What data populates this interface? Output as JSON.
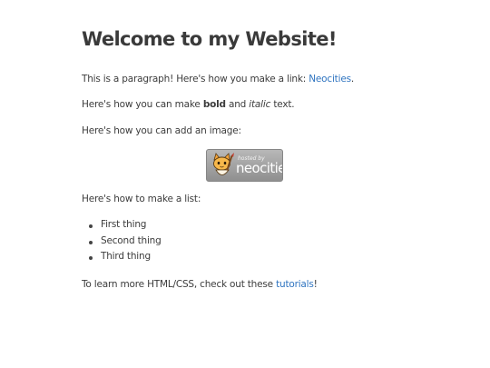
{
  "page": {
    "title": "Welcome to my Website!",
    "p1_text": "This is a paragraph! Here's how you make a link: ",
    "p1_link": "Neocities",
    "p1_end": ".",
    "p2_pre": "Here's how you can make ",
    "p2_bold": "bold",
    "p2_mid": " and ",
    "p2_italic": "italic",
    "p2_end": " text.",
    "p3_text": "Here's how you can add an image:",
    "badge_small": "hosted by",
    "badge_big": "neocities",
    "p4_text": "Here's how to make a list:",
    "list_items": [
      "First thing",
      "Second thing",
      "Third thing"
    ],
    "p5_text": "To learn more HTML/CSS, check out these ",
    "p5_link": "tutorials",
    "p5_end": "!"
  },
  "colors": {
    "link": "#2f74c0",
    "text": "#333333",
    "badge": "#a5a5a5"
  },
  "icons": {
    "badge_mascot": "neocities-cat-icon"
  }
}
